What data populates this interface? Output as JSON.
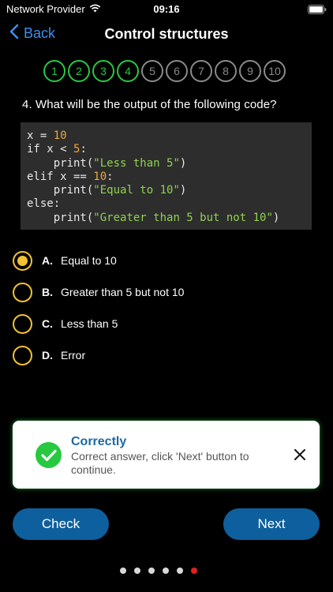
{
  "status_bar": {
    "carrier": "Network Provider",
    "time": "09:16",
    "wifi_icon": "wifi-icon",
    "battery_icon": "battery-icon"
  },
  "nav": {
    "back_label": "Back",
    "back_icon": "chevron-left-icon",
    "title": "Control structures"
  },
  "steps": [
    {
      "label": "1",
      "state": "done"
    },
    {
      "label": "2",
      "state": "done"
    },
    {
      "label": "3",
      "state": "done"
    },
    {
      "label": "4",
      "state": "done"
    },
    {
      "label": "5",
      "state": "pending"
    },
    {
      "label": "6",
      "state": "pending"
    },
    {
      "label": "7",
      "state": "pending"
    },
    {
      "label": "8",
      "state": "pending"
    },
    {
      "label": "9",
      "state": "pending"
    },
    {
      "label": "10",
      "state": "pending"
    }
  ],
  "question": {
    "text": "4. What will be the output of the following code?",
    "code_lines": [
      "x = 10",
      "if x < 5:",
      "    print(\"Less than 5\")",
      "elif x == 10:",
      "    print(\"Equal to 10\")",
      "else:",
      "    print(\"Greater than 5 but not 10\")"
    ]
  },
  "options": [
    {
      "letter": "A.",
      "text": "Equal to 10",
      "selected": true
    },
    {
      "letter": "B.",
      "text": "Greater than 5 but not 10",
      "selected": false
    },
    {
      "letter": "C.",
      "text": "Less than 5",
      "selected": false
    },
    {
      "letter": "D.",
      "text": "Error",
      "selected": false
    }
  ],
  "result": {
    "title": "Correctly",
    "message": "Correct answer, click 'Next' button to continue.",
    "icon": "check-circle-icon",
    "close_icon": "close-icon"
  },
  "buttons": {
    "check_label": "Check",
    "next_label": "Next"
  },
  "pagination": {
    "count": 6,
    "active_index": 5
  },
  "colors": {
    "accent_blue": "#3b8ef0",
    "button_blue": "#0e5f9d",
    "correct_green": "#28c840",
    "option_yellow": "#f1c232",
    "code_background": "#2d2d2d",
    "code_number": "#f0a73a",
    "code_string": "#8fd14f",
    "active_dot": "#e02020"
  }
}
